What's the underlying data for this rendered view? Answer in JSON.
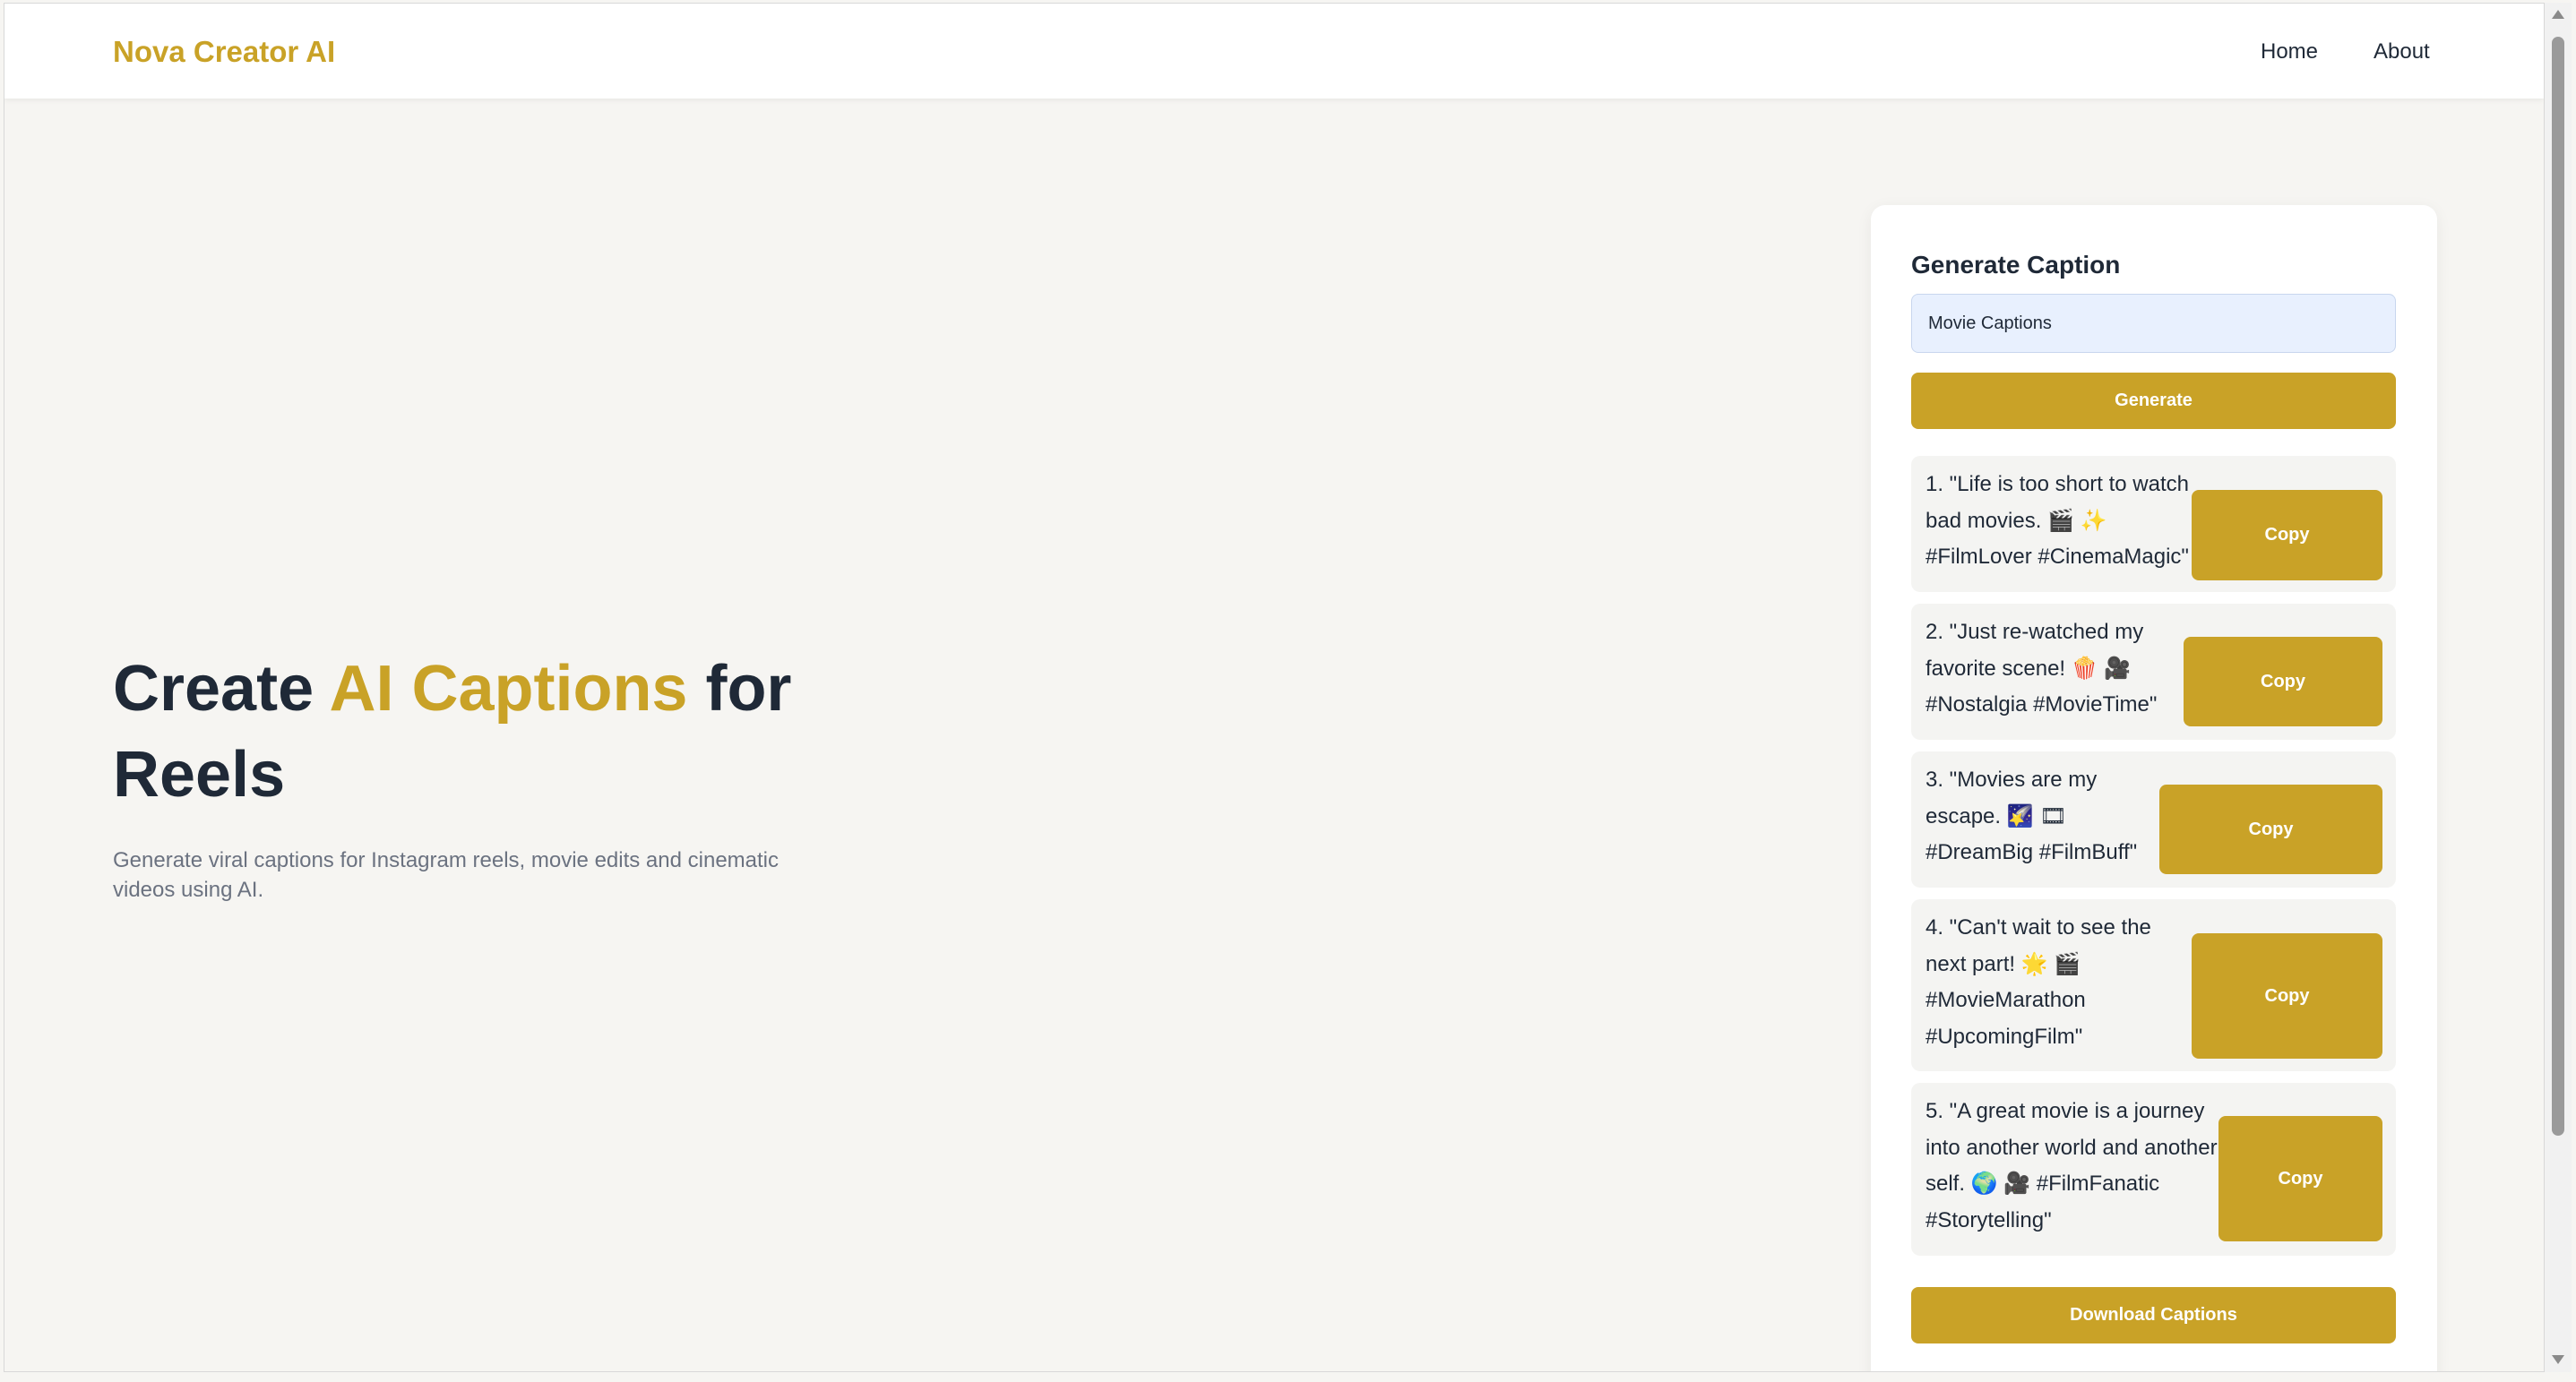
{
  "nav": {
    "brand": "Nova Creator AI",
    "links": [
      "Home",
      "About"
    ]
  },
  "hero": {
    "title_pre": "Create ",
    "title_accent": "AI Captions",
    "title_post": " for Reels",
    "subtitle": "Generate viral captions for Instagram reels, movie edits and cinematic videos using AI."
  },
  "panel": {
    "title": "Generate Caption",
    "input_value": "Movie Captions",
    "generate_label": "Generate",
    "download_label": "Download Captions",
    "copy_label": "Copy",
    "captions": [
      "1. \"Life is too short to watch bad movies. 🎬 ✨ #FilmLover #CinemaMagic\"",
      "2. \"Just re-watched my favorite scene! 🍿 🎥 #Nostalgia #MovieTime\"",
      "3. \"Movies are my escape. 🌠 🎞 #DreamBig #FilmBuff\"",
      "4. \"Can't wait to see the next part! 🌟 🎬 #MovieMarathon #UpcomingFilm\"",
      "5. \"A great movie is a journey into another world and another self. 🌍 🎥 #FilmFanatic #Storytelling\""
    ]
  },
  "colors": {
    "accent": "#c9a227",
    "background": "#f6f5f2",
    "heading": "#1f2937",
    "muted": "#6b7280"
  }
}
